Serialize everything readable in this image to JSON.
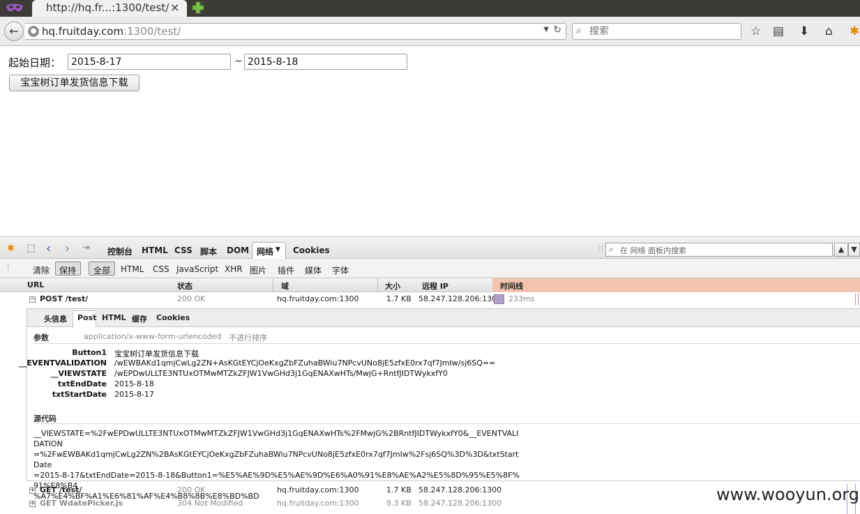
{
  "browser": {
    "tab_title": "http://hq.fr...:1300/test/",
    "tab_close": "×",
    "url_host": "hq.fruitday.com",
    "url_rest": ":1300/test/",
    "search_placeholder": "搜索"
  },
  "page": {
    "start_label": "起始日期：",
    "start_date": "2015-8-17",
    "tilde": "~",
    "end_date": "2015-8-18",
    "download_button": "宝宝树订单发货信息下载"
  },
  "firebug": {
    "panels": [
      "控制台",
      "HTML",
      "CSS",
      "脚本",
      "DOM",
      "网络",
      "Cookies"
    ],
    "search_placeholder": "在 网络 面板内搜索",
    "clear": "清除",
    "persist": "保持",
    "filters": [
      "全部",
      "HTML",
      "CSS",
      "JavaScript",
      "XHR",
      "图片",
      "插件",
      "媒体",
      "字体"
    ],
    "columns": {
      "url": "URL",
      "status": "状态",
      "domain": "域",
      "size": "大小",
      "remote_ip": "远程 IP",
      "timeline": "时间线"
    },
    "requests": [
      {
        "url": "POST /test/",
        "status": "200 OK",
        "domain": "hq.fruitday.com:1300",
        "size": "1.7 KB",
        "ip": "58.247.128.206:1300",
        "time": "233ms",
        "expanded": true
      },
      {
        "url": "GET /test/",
        "status": "200 OK",
        "domain": "hq.fruitday.com:1300",
        "size": "1.7 KB",
        "ip": "58.247.128.206:1300"
      },
      {
        "url": "GET WdatePicker.js",
        "status": "304 Not Modified",
        "domain": "hq.fruitday.com:1300",
        "size": "8.3 KB",
        "ip": "58.247.128.206:1300"
      }
    ],
    "detail": {
      "tabs": [
        "头信息",
        "Post",
        "HTML",
        "缓存",
        "Cookies"
      ],
      "params_title": "参数",
      "content_type": "application/x-www-form-urlencoded",
      "no_sort": "不进行排序",
      "params": [
        {
          "k": "Button1",
          "v": "宝宝树订单发货信息下载"
        },
        {
          "k": "__EVENTVALIDATION",
          "v": "/wEWBAKd1qmjCwLg2ZN+AsKGtEYCjOeKxgZbFZuhaBWiu7NPcvUNo8jE5zfxE0rx7qf7JmIw/sj6SQ=="
        },
        {
          "k": "__VIEWSTATE",
          "v": "/wEPDwULLTE3NTUxOTMwMTZkZFJW1VwGHd3j1GqENAXwHTs/MwjG+RntfJIDTWykxfY0"
        },
        {
          "k": "txtEndDate",
          "v": "2015-8-18"
        },
        {
          "k": "txtStartDate",
          "v": "2015-8-17"
        }
      ],
      "source_title": "源代码",
      "source_lines": [
        "__VIEWSTATE=%2FwEPDwULLTE3NTUxOTMwMTZkZFJW1VwGHd3j1GqENAXwHTs%2FMwjG%2BRntfJIDTWykxfY0&__EVENTVALIDATION",
        "=%2FwEWBAKd1qmjCwLg2ZN%2BAsKGtEYCjOeKxgZbFZuhaBWiu7NPcvUNo8jE5zfxE0rx7qf7JmIw%2Fsj6SQ%3D%3D&txtStartDate",
        "=2015-8-17&txtEndDate=2015-8-18&Button1=%E5%AE%9D%E5%AE%9D%E6%A0%91%E8%AE%A2%E5%8D%95%E5%8F%91%E8%B4",
        "%A7%E4%BF%A1%E6%81%AF%E4%B8%8B%E8%BD%BD"
      ]
    }
  },
  "watermark": "www.wooyun.org"
}
